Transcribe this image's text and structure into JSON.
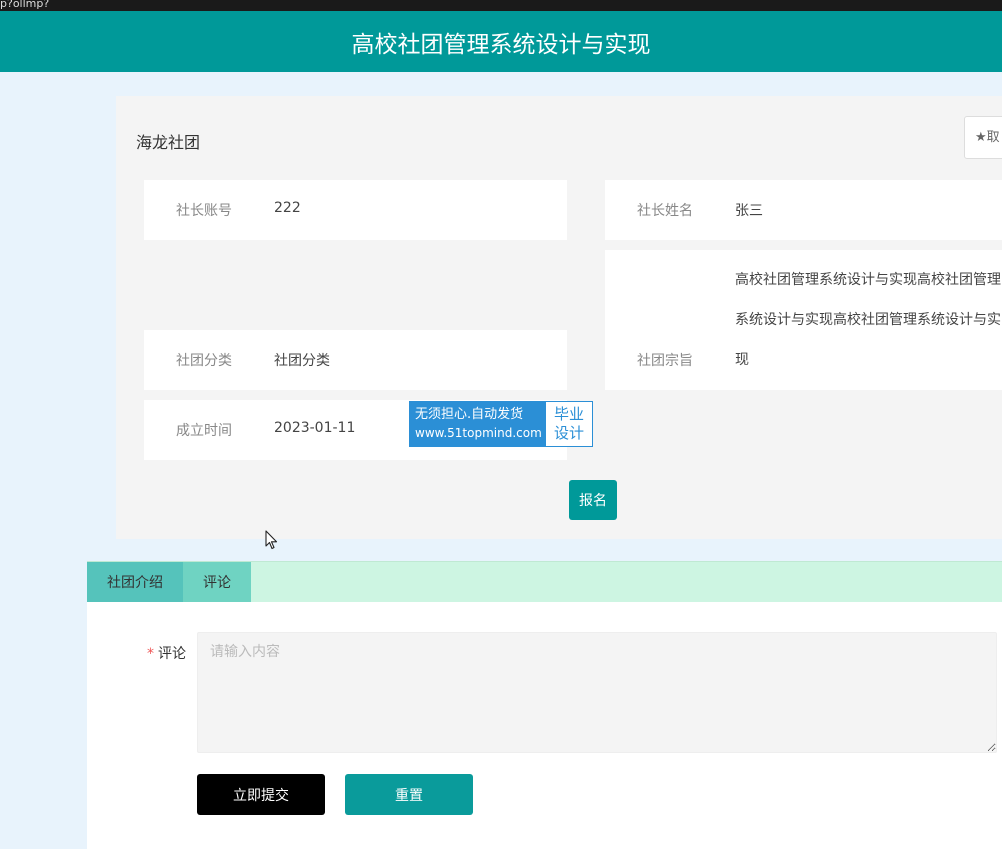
{
  "topbar": {
    "text": "p?ollmp?"
  },
  "header": {
    "title": "高校社团管理系统设计与实现"
  },
  "detail": {
    "club_name": "海龙社团",
    "favorite_label": "★取",
    "fields": {
      "leader_account": {
        "label": "社长账号",
        "value": "222"
      },
      "leader_name": {
        "label": "社长姓名",
        "value": "张三"
      },
      "category": {
        "label": "社团分类",
        "value": "社团分类"
      },
      "purpose": {
        "label": "社团宗旨",
        "value": "高校社团管理系统设计与实现高校社团管理系统设计与实现高校社团管理系统设计与实现"
      },
      "founded": {
        "label": "成立时间",
        "value": "2023-01-11"
      }
    },
    "signup_label": "报名"
  },
  "watermark": {
    "line1": "无须担心.自动发货",
    "line2": "www.51topmind.com",
    "right1": "毕业",
    "right2": "设计"
  },
  "tabs": [
    {
      "label": "社团介绍"
    },
    {
      "label": "评论"
    }
  ],
  "comment_form": {
    "required_mark": "*",
    "label": "评论",
    "placeholder": "请输入内容",
    "submit_label": "立即提交",
    "reset_label": "重置"
  },
  "colors": {
    "header": "#009999",
    "signup": "#009999",
    "tab_bar": "#cdf5e2",
    "submit": "#000000",
    "reset": "#0a9b9b"
  }
}
